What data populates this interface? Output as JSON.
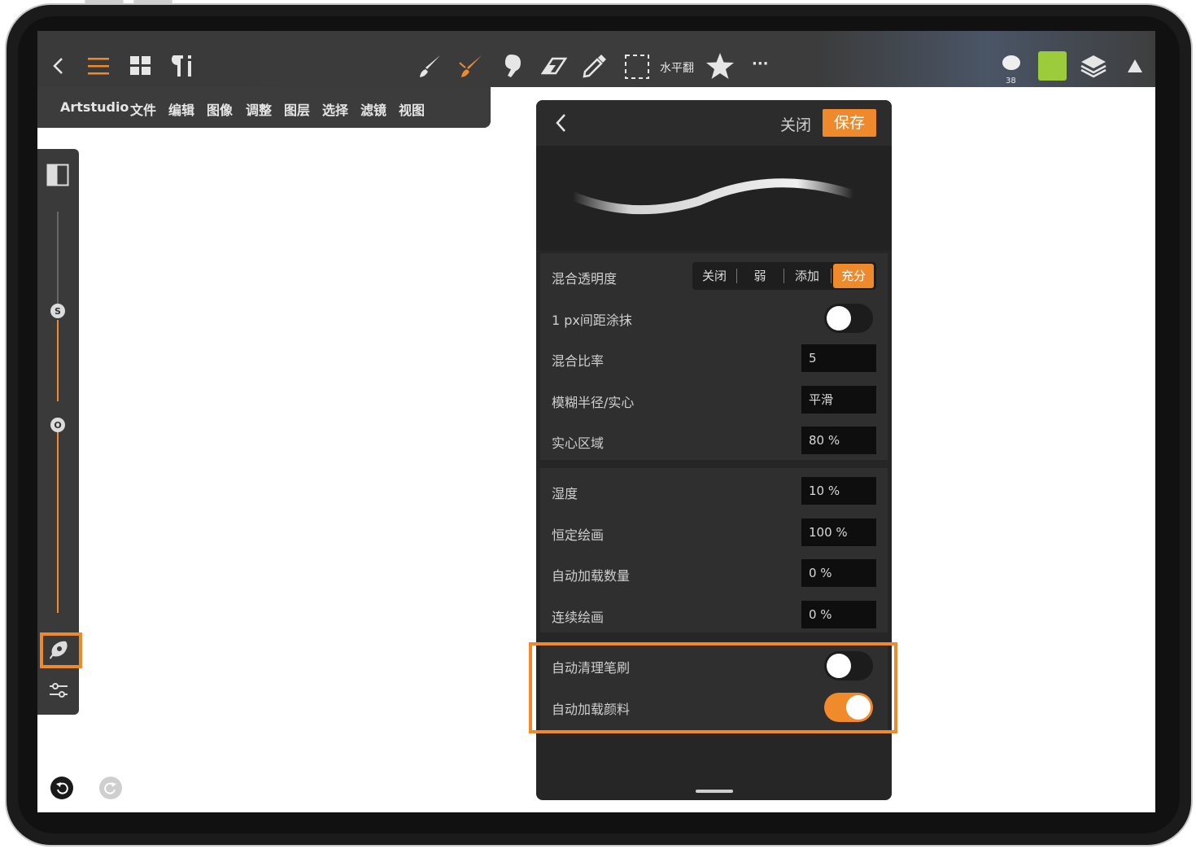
{
  "app": {
    "menu": [
      "Artstudio",
      "文件",
      "编辑",
      "图像",
      "调整",
      "图层",
      "选择",
      "滤镜",
      "视图"
    ],
    "toolbar": {
      "flip_label": "水平翻",
      "more_label": "···",
      "brush_size": "38",
      "current_color": "#9ccc3c"
    }
  },
  "left_tools": {
    "size_knob": "S",
    "opacity_knob": "O"
  },
  "brush_panel": {
    "close_label": "关闭",
    "save_label": "保存",
    "blend_opacity": {
      "label": "混合透明度",
      "options": [
        "关闭",
        "弱",
        "添加",
        "充分"
      ],
      "selected": "充分"
    },
    "rows_a": [
      {
        "label": "1 px间距涂抹",
        "type": "toggle",
        "on": false
      },
      {
        "label": "混合比率",
        "value": "5"
      },
      {
        "label": "模糊半径/实心",
        "value": "平滑"
      },
      {
        "label": "实心区域",
        "value": "80 %"
      }
    ],
    "rows_b": [
      {
        "label": "湿度",
        "value": "10 %"
      },
      {
        "label": "恒定绘画",
        "value": "100 %"
      },
      {
        "label": "自动加载数量",
        "value": "0 %"
      },
      {
        "label": "连续绘画",
        "value": "0 %"
      }
    ],
    "rows_c": [
      {
        "label": "自动清理笔刷",
        "type": "toggle",
        "on": false
      },
      {
        "label": "自动加载颜料",
        "type": "toggle",
        "on": true
      }
    ]
  },
  "colors": {
    "accent": "#ef8a2c",
    "panel_bg": "#262626",
    "toolbar_bg": "#3c3c3c"
  }
}
